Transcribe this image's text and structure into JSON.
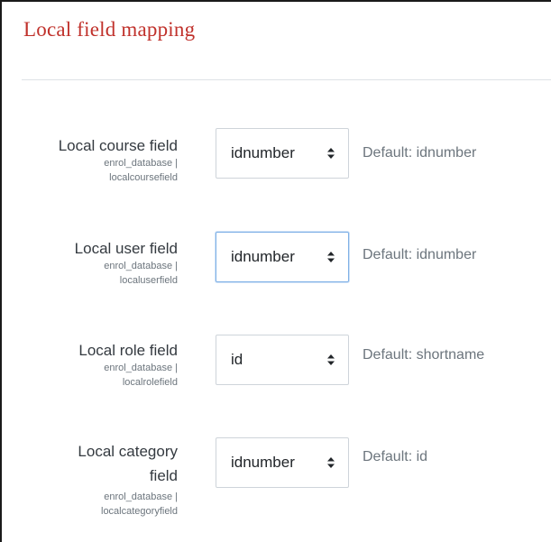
{
  "section": {
    "title": "Local field mapping"
  },
  "settings": [
    {
      "label": "Local course field",
      "name_line1": "enrol_database |",
      "name_line2": "localcoursefield",
      "value": "idnumber",
      "default": "Default: idnumber",
      "focused": false
    },
    {
      "label": "Local user field",
      "name_line1": "enrol_database |",
      "name_line2": "localuserfield",
      "value": "idnumber",
      "default": "Default: idnumber",
      "focused": true
    },
    {
      "label": "Local role field",
      "name_line1": "enrol_database |",
      "name_line2": "localrolefield",
      "value": "id",
      "default": "Default: shortname",
      "focused": false
    },
    {
      "label_line1": "Local category",
      "label_line2": "field",
      "name_line1": "enrol_database |",
      "name_line2": "localcategoryfield",
      "value": "idnumber",
      "default": "Default: id",
      "focused": false
    }
  ],
  "icons": {
    "select_caret": "sort-caret-icon"
  }
}
